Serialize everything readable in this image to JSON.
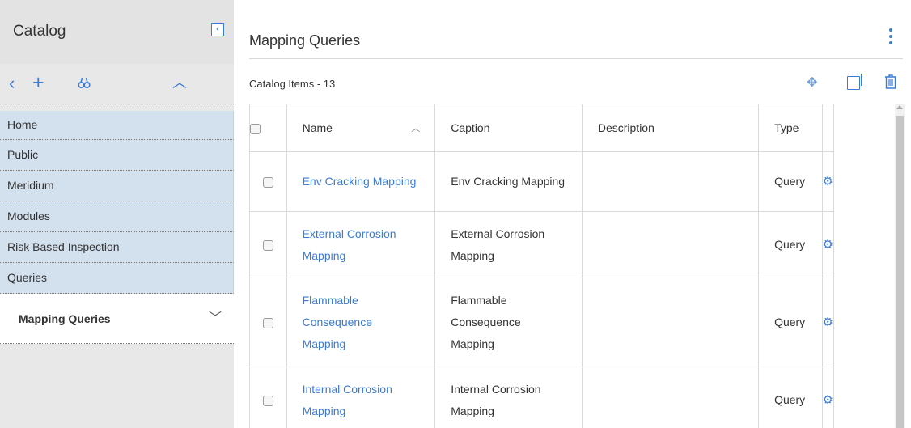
{
  "sidebar": {
    "title": "Catalog",
    "collapse_icon": "‹",
    "tools": {
      "back": "‹",
      "add": "+",
      "find": "🔍",
      "up": "︿"
    },
    "nav_items": [
      {
        "label": "Home"
      },
      {
        "label": "Public"
      },
      {
        "label": "Meridium"
      },
      {
        "label": "Modules"
      },
      {
        "label": "Risk Based Inspection"
      },
      {
        "label": "Queries"
      }
    ],
    "current": {
      "label": "Mapping Queries",
      "chevron": "﹀"
    }
  },
  "main": {
    "title": "Mapping Queries",
    "items_label": "Catalog Items - 13",
    "actions": {
      "move_icon": "✥",
      "copy_icon": "copy-icon",
      "delete_icon": "trash-icon"
    }
  },
  "table": {
    "columns": [
      "Name",
      "Caption",
      "Description",
      "Type"
    ],
    "sort_indicator": "︿",
    "rows": [
      {
        "name": "Env Cracking Mapping",
        "caption": "Env Cracking Mapping",
        "description": "",
        "type": "Query"
      },
      {
        "name": "External Corrosion Mapping",
        "caption": "External Corrosion Mapping",
        "description": "",
        "type": "Query"
      },
      {
        "name": "Flammable Consequence Mapping",
        "caption": "Flammable Consequence Mapping",
        "description": "",
        "type": "Query"
      },
      {
        "name": "Internal Corrosion Mapping",
        "caption": "Internal Corrosion Mapping",
        "description": "",
        "type": "Query"
      }
    ],
    "gear_glyph": "⚙"
  },
  "colors": {
    "accent": "#3a7bd5",
    "sidebar_bg": "#e8e8e8",
    "nav_item_bg": "#d3e0ee"
  }
}
